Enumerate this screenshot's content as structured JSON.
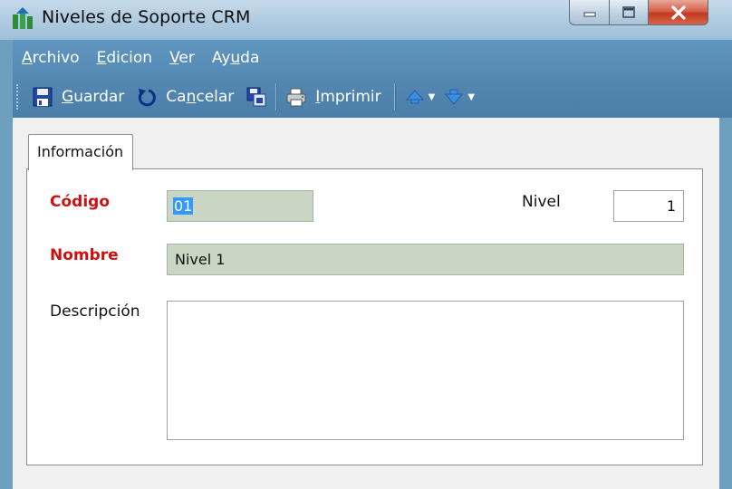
{
  "window": {
    "title": "Niveles de Soporte CRM",
    "icon": "app-tree-icon"
  },
  "menu": {
    "items": [
      {
        "accel": "A",
        "rest": "rchivo"
      },
      {
        "accel": "E",
        "rest": "dicion"
      },
      {
        "accel": "V",
        "rest": "er"
      },
      {
        "pre": "Ay",
        "accel": "u",
        "rest": "da"
      }
    ]
  },
  "toolbar": {
    "save_accel": "G",
    "save_rest": "uardar",
    "cancel_pre": "Ca",
    "cancel_accel": "n",
    "cancel_rest": "celar",
    "print_accel": "I",
    "print_rest": "mprimir"
  },
  "tab": {
    "label": "Información"
  },
  "form": {
    "codigo_label": "Código",
    "codigo_value": "01",
    "nivel_label": "Nivel",
    "nivel_value": "1",
    "nombre_label": "Nombre",
    "nombre_value": "Nivel 1",
    "descripcion_label": "Descripción",
    "descripcion_value": ""
  },
  "colors": {
    "required_label": "#cc1111",
    "field_bg": "#c8d6c3",
    "menu_bg": "#5286b1",
    "selection": "#3399ff"
  }
}
